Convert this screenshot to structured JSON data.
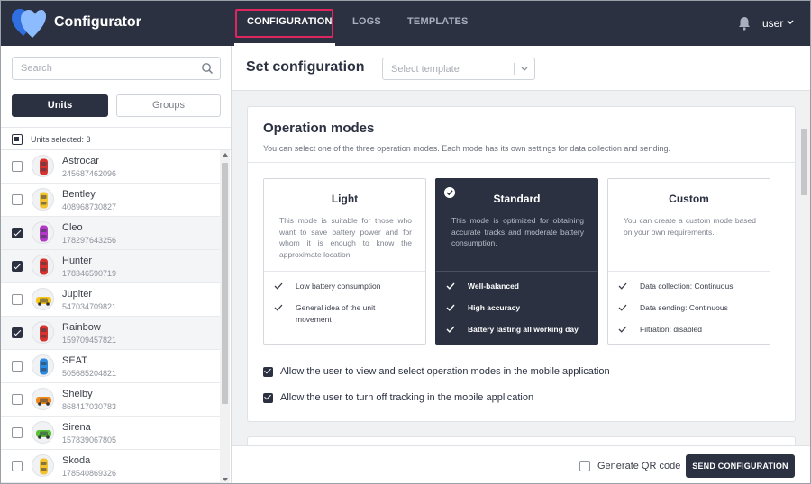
{
  "app": {
    "title": "Configurator"
  },
  "nav": {
    "tabs": [
      {
        "label": "CONFIGURATION",
        "active": true
      },
      {
        "label": "LOGS",
        "active": false
      },
      {
        "label": "TEMPLATES",
        "active": false
      }
    ],
    "user": "user"
  },
  "sidebar": {
    "search_placeholder": "Search",
    "units_label": "Units",
    "groups_label": "Groups",
    "selected_text": "Units selected: 3",
    "units": [
      {
        "name": "Astrocar",
        "id": "245687462096",
        "checked": false,
        "icon": "car-red-icon"
      },
      {
        "name": "Bentley",
        "id": "408968730827",
        "checked": false,
        "icon": "car-yellow-icon"
      },
      {
        "name": "Cleo",
        "id": "178297643256",
        "checked": true,
        "icon": "car-purple-icon"
      },
      {
        "name": "Hunter",
        "id": "178346590719",
        "checked": true,
        "icon": "car-red-icon"
      },
      {
        "name": "Jupiter",
        "id": "547034709821",
        "checked": false,
        "icon": "taxi-icon"
      },
      {
        "name": "Rainbow",
        "id": "159709457821",
        "checked": true,
        "icon": "car-red-icon"
      },
      {
        "name": "SEAT",
        "id": "505685204821",
        "checked": false,
        "icon": "car-blue-icon"
      },
      {
        "name": "Shelby",
        "id": "868417030783",
        "checked": false,
        "icon": "car-orange-icon"
      },
      {
        "name": "Sirena",
        "id": "157839067805",
        "checked": false,
        "icon": "car-green-icon"
      },
      {
        "name": "Skoda",
        "id": "178540869326",
        "checked": false,
        "icon": "car-yellow-icon"
      }
    ]
  },
  "main": {
    "title": "Set configuration",
    "template_placeholder": "Select template",
    "card": {
      "title": "Operation modes",
      "subtitle": "You can select one of the three operation modes. Each mode has its own settings for data collection and sending.",
      "modes": [
        {
          "name": "Light",
          "selected": false,
          "description": "This mode is suitable for those who want to save battery power and for whom it is enough to know the approximate location.",
          "features": [
            "Low battery consumption",
            "General idea of the unit movement"
          ]
        },
        {
          "name": "Standard",
          "selected": true,
          "description": "This mode is optimized for obtaining accurate tracks and moderate battery consumption.",
          "features": [
            "Well-balanced",
            "High accuracy",
            "Battery lasting all working day"
          ]
        },
        {
          "name": "Custom",
          "selected": false,
          "description": "You can create a custom mode based on your own requirements.",
          "features": [
            "Data collection: Continuous",
            "Data sending: Continuous",
            "Filtration: disabled"
          ]
        }
      ],
      "options": [
        {
          "label": "Allow the user to view and select operation modes in the mobile application",
          "checked": true
        },
        {
          "label": "Allow the user to turn off tracking in the mobile application",
          "checked": true
        }
      ]
    },
    "footer": {
      "qr_label": "Generate QR code",
      "send_label": "SEND CONFIGURATION"
    }
  },
  "colors": {
    "header_bg": "#2b3141",
    "accent_highlight": "#e0245e",
    "logo_light": "#7fb2ff",
    "logo_dark": "#2f6fe0"
  }
}
